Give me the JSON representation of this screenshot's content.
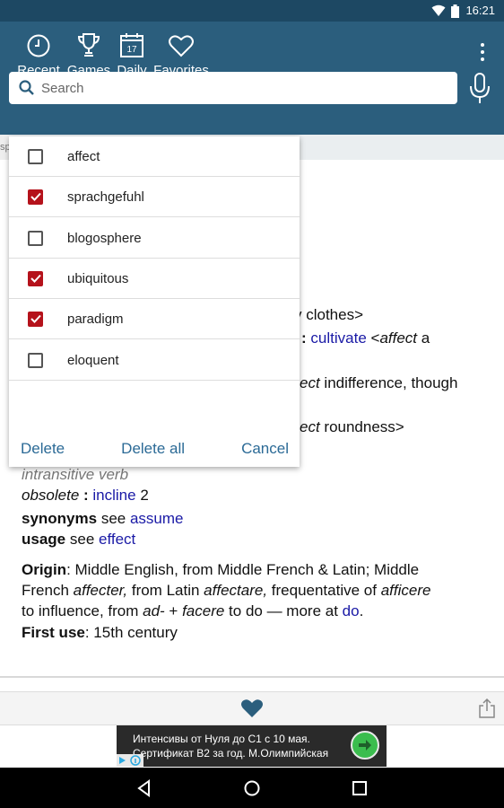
{
  "status": {
    "time": "16:21"
  },
  "nav": [
    {
      "label": "Recent",
      "icon": "clock-icon"
    },
    {
      "label": "Games",
      "icon": "trophy-icon"
    },
    {
      "label": "Daily",
      "icon": "calendar-icon",
      "badge": "17"
    },
    {
      "label": "Favorites",
      "icon": "heart-outline-icon"
    }
  ],
  "search": {
    "placeholder": "Search"
  },
  "side_tab": "sp",
  "history_dropdown": {
    "items": [
      {
        "word": "affect",
        "checked": false
      },
      {
        "word": "sprachgefuhl",
        "checked": true
      },
      {
        "word": "blogosphere",
        "checked": false
      },
      {
        "word": "ubiquitous",
        "checked": true
      },
      {
        "word": "paradigm",
        "checked": true
      },
      {
        "word": "eloquent",
        "checked": false
      }
    ],
    "actions": {
      "delete": "Delete",
      "delete_all": "Delete all",
      "cancel": "Cancel"
    }
  },
  "definition": {
    "frag1": "y clothes>",
    "frag2_colon": ":",
    "frag2_link": "cultivate",
    "frag2_rest_a": " <",
    "frag2_italic": "affect",
    "frag2_rest_b": " a",
    "frag3_italic": "ect",
    "frag3_rest": " indifference, though",
    "frag4_italic": "ect",
    "frag4_rest": " roundness>",
    "pos": "intransitive verb",
    "obsolete_label": "obsolete",
    "obsolete_colon": " : ",
    "obsolete_link": "incline",
    "obsolete_num": " 2",
    "synonyms_label": "synonyms",
    "synonyms_see": " see ",
    "synonyms_link": "assume",
    "usage_label": "usage",
    "usage_see": " see ",
    "usage_link": "effect",
    "origin_label": "Origin",
    "origin_l1": ": Middle English, from Middle French & Latin; Middle",
    "origin_l2a": "French ",
    "origin_l2b": "affecter,",
    "origin_l2c": " from Latin ",
    "origin_l2d": "affectare,",
    "origin_l2e": " frequentative of ",
    "origin_l2f": "afficere",
    "origin_l3a": "to influence, from ",
    "origin_l3b": "ad-",
    "origin_l3c": " + ",
    "origin_l3d": "facere",
    "origin_l3e": " to do — more at ",
    "origin_l3f": "do",
    "origin_l3g": ".",
    "first_use_label": "First use",
    "first_use_value": ": 15th century"
  },
  "ad": {
    "line1": "Интенсивы от Нуля до С1 с 10 мая.",
    "line2": "Сертификат В2 за год. М.Олимпийская"
  },
  "colors": {
    "appbar": "#2b5e7d",
    "accent_link": "#1a1aa6",
    "checkbox": "#b5121b"
  }
}
